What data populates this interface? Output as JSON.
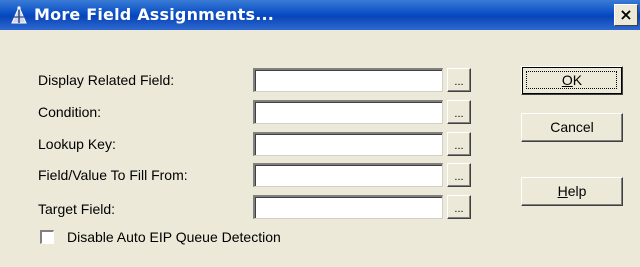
{
  "window": {
    "title": "More Field Assignments...",
    "close_glyph": "×"
  },
  "form": {
    "rows": [
      {
        "label": "Display Related Field:",
        "value": "",
        "browse": "..."
      },
      {
        "label": "Condition:",
        "value": "",
        "browse": "..."
      },
      {
        "label": "Lookup Key:",
        "value": "",
        "browse": "..."
      },
      {
        "label": "Field/Value To Fill From:",
        "value": "",
        "browse": "..."
      },
      {
        "label": "Target Field:",
        "value": "",
        "browse": "..."
      }
    ],
    "checkbox": {
      "label": "Disable Auto EIP Queue Detection",
      "checked": false
    }
  },
  "buttons": {
    "ok": {
      "accel": "O",
      "rest": "K"
    },
    "cancel": "Cancel",
    "help": {
      "accel": "H",
      "rest": "elp"
    }
  },
  "icons": {
    "title_icon": "wizard-icon",
    "close_icon": "close-icon"
  },
  "colors": {
    "titlebar": "#0a4fc7",
    "dialog_bg": "#ece9d8",
    "title_text": "#ffffff"
  }
}
